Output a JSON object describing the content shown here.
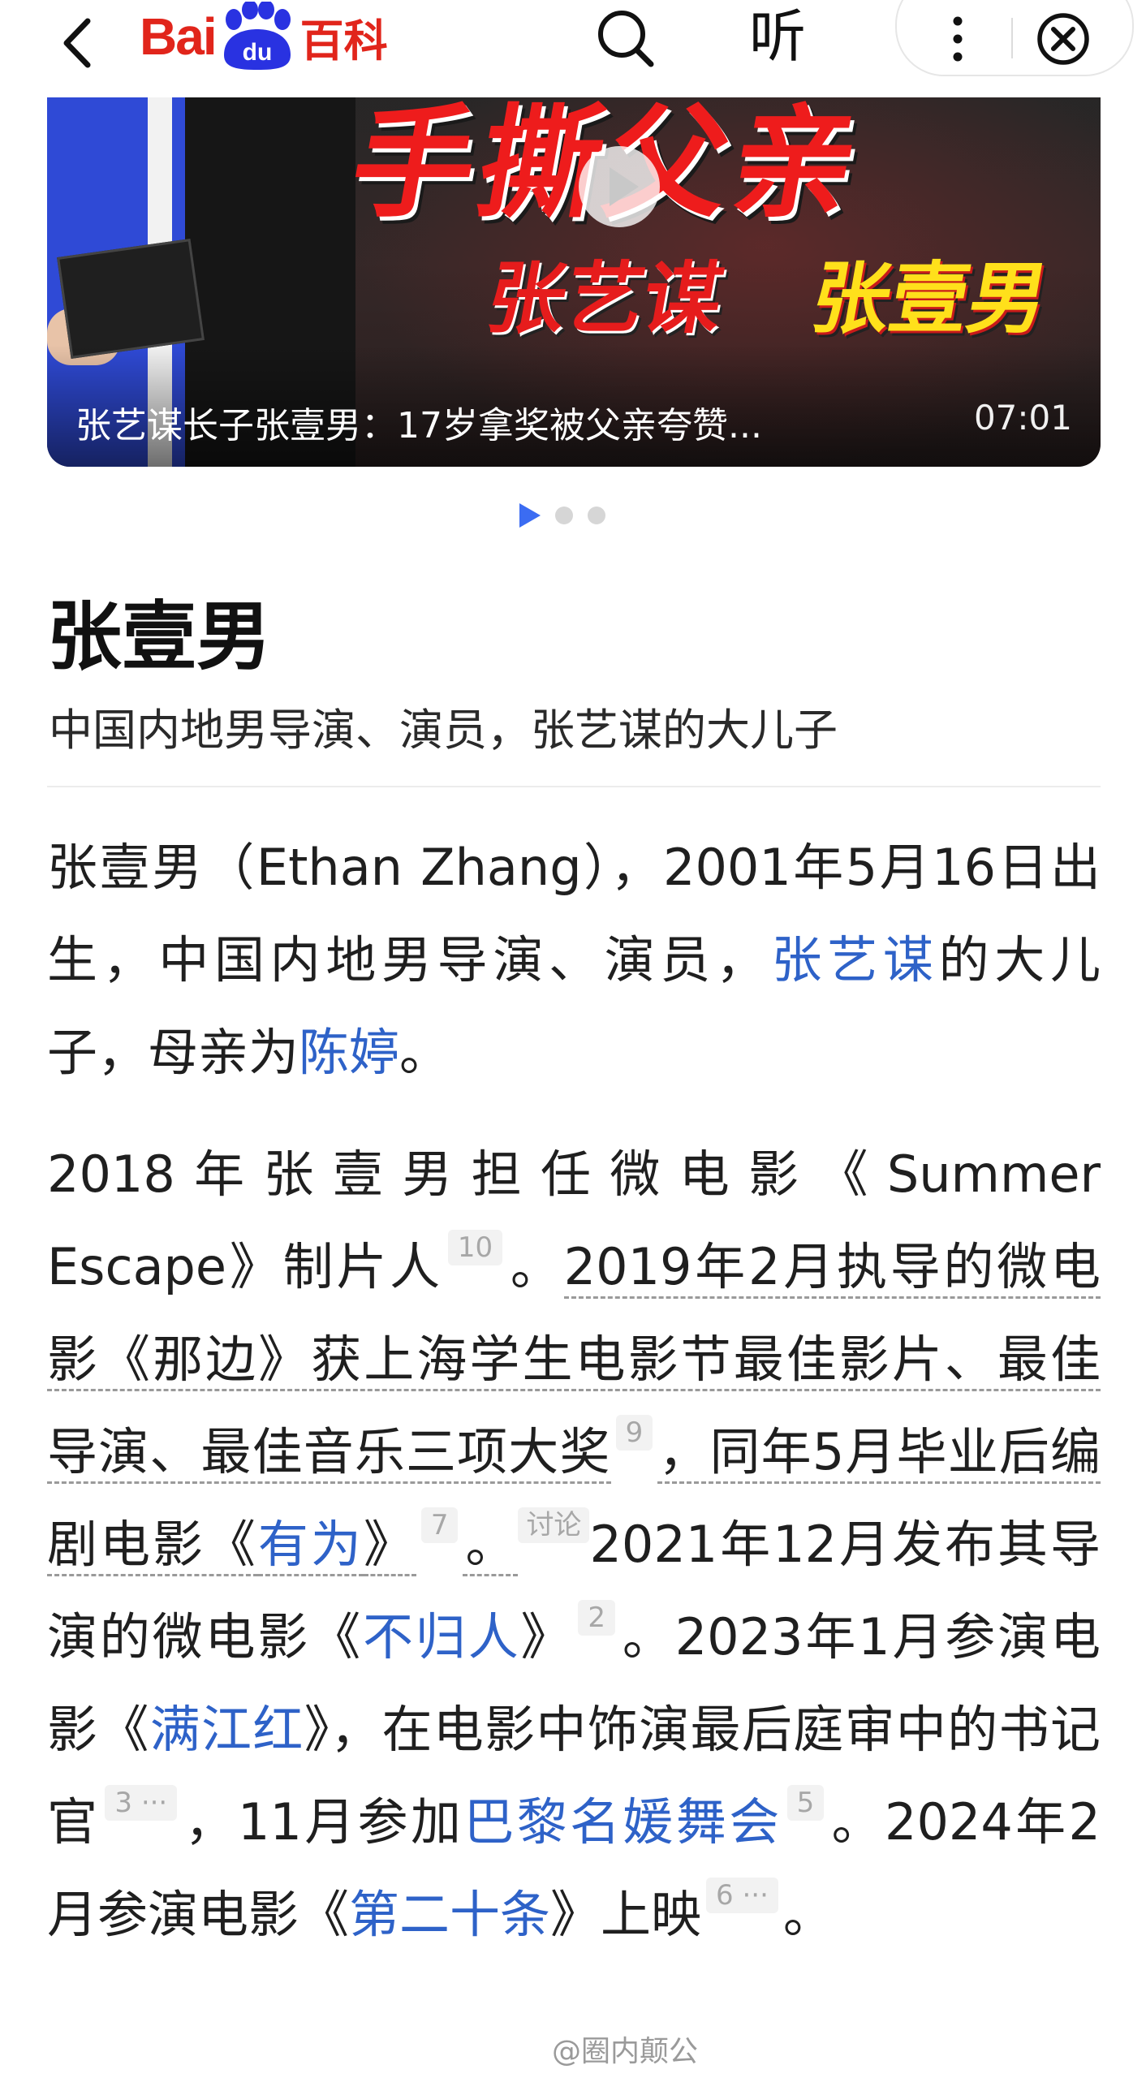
{
  "header": {
    "back_icon": "chevron-left-icon",
    "logo_bai": "Bai",
    "logo_du": "du",
    "logo_baike": "百科",
    "listen_label": "听",
    "search_icon": "search-icon",
    "more_icon": "more-vertical-icon",
    "close_icon": "close-circle-icon"
  },
  "banner": {
    "headline_text": "手撕父亲",
    "name_left": "张艺谋",
    "name_right": "张壹男",
    "caption": "张艺谋长子张壹男：17岁拿奖被父亲夸赞...",
    "duration": "07:01",
    "carousel_count": 3,
    "carousel_active": 1
  },
  "article": {
    "title": "张壹男",
    "subtitle": "中国内地男导演、演员，张艺谋的大儿子",
    "p1": {
      "t1": "张壹男（Ethan Zhang），2001年5月16日出生，中国内地男导演、演员，",
      "link_father": "张艺谋",
      "t2": "的大儿子，母亲为",
      "link_mother": "陈婷",
      "t3": "。"
    },
    "p2": {
      "t1": "2018年张壹男担任微电影《Summer Escape》制片人",
      "ref1": "10",
      "t2": "。",
      "u1": "2019年2月执导的微电影《那边》获上海学生电影节最佳影片、最佳导演、最佳音乐三项大奖",
      "ref2": "9",
      "u2a": "，同年5月毕业后编剧电影《",
      "link_youwei": "有为",
      "u2b": "》",
      "ref3": "7",
      "u3": "。",
      "discuss": "讨论",
      "t3": "2021年12月发布其导演的微电影《",
      "link_buguiren": "不归人",
      "t4": "》",
      "ref4": "2",
      "t5": "。2023年1月参演电影《",
      "link_manjianghong": "满江红",
      "t6": "》，在电影中饰演最后庭审中的书记官",
      "ref5": "3 ···",
      "t7": "，11月参加",
      "link_ball": "巴黎名媛舞会",
      "ref6": "5",
      "t8": "。2024年2月参演电影《",
      "link_twenty": "第二十条",
      "t9": "》上映",
      "ref7": "6 ···",
      "t10": "。"
    }
  },
  "watermark": "@圈内颠公",
  "colors": {
    "brand_red": "#e1251b",
    "brand_blue": "#2932e1",
    "link_blue": "#2e62c8",
    "carousel_active": "#3b6cf2"
  }
}
